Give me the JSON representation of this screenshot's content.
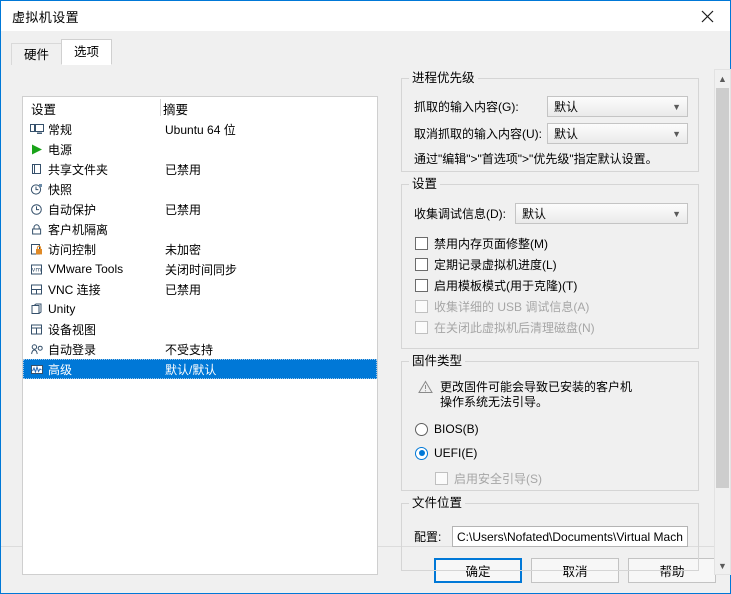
{
  "window": {
    "title": "虚拟机设置",
    "close_icon": "close-icon"
  },
  "tabs": [
    {
      "label": "硬件",
      "active": false
    },
    {
      "label": "选项",
      "active": true
    }
  ],
  "settings_list": {
    "columns": [
      "设置",
      "摘要"
    ],
    "rows": [
      {
        "icon": "monitor-icon",
        "label": "常规",
        "summary": "Ubuntu 64 位",
        "selected": false
      },
      {
        "icon": "power-play-icon",
        "label": "电源",
        "summary": "",
        "selected": false
      },
      {
        "icon": "shared-folder-icon",
        "label": "共享文件夹",
        "summary": "已禁用",
        "selected": false
      },
      {
        "icon": "snapshot-icon",
        "label": "快照",
        "summary": "",
        "selected": false
      },
      {
        "icon": "autoprotect-icon",
        "label": "自动保护",
        "summary": "已禁用",
        "selected": false
      },
      {
        "icon": "lock-icon",
        "label": "客户机隔离",
        "summary": "",
        "selected": false
      },
      {
        "icon": "access-control-icon",
        "label": "访问控制",
        "summary": "未加密",
        "selected": false
      },
      {
        "icon": "vmware-tools-icon",
        "label": "VMware Tools",
        "summary": "关闭时间同步",
        "selected": false
      },
      {
        "icon": "vnc-icon",
        "label": "VNC 连接",
        "summary": "已禁用",
        "selected": false
      },
      {
        "icon": "unity-icon",
        "label": "Unity",
        "summary": "",
        "selected": false
      },
      {
        "icon": "device-view-icon",
        "label": "设备视图",
        "summary": "",
        "selected": false
      },
      {
        "icon": "autologon-icon",
        "label": "自动登录",
        "summary": "不受支持",
        "selected": false
      },
      {
        "icon": "advanced-icon",
        "label": "高级",
        "summary": "默认/默认",
        "selected": true
      }
    ]
  },
  "options": {
    "process_priority": {
      "title": "进程优先级",
      "grab_label": "抓取的输入内容(G):",
      "grab_value": "默认",
      "ungrab_label": "取消抓取的输入内容(U):",
      "ungrab_value": "默认",
      "hint": "通过\"编辑\">\"首选项\">\"优先级\"指定默认设置。"
    },
    "settings": {
      "title": "设置",
      "debug_label": "收集调试信息(D):",
      "debug_value": "默认",
      "checkboxes": [
        {
          "label": "禁用内存页面修整(M)",
          "checked": false,
          "disabled": false
        },
        {
          "label": "定期记录虚拟机进度(L)",
          "checked": false,
          "disabled": false
        },
        {
          "label": "启用模板模式(用于克隆)(T)",
          "checked": false,
          "disabled": false
        },
        {
          "label": "收集详细的 USB 调试信息(A)",
          "checked": false,
          "disabled": true
        },
        {
          "label": "在关闭此虚拟机后清理磁盘(N)",
          "checked": false,
          "disabled": true
        }
      ]
    },
    "firmware": {
      "title": "固件类型",
      "warning_icon": "warning-triangle-icon",
      "warning_line1": "更改固件可能会导致已安装的客户机",
      "warning_line2": "操作系统无法引导。",
      "radios": [
        {
          "label": "BIOS(B)",
          "checked": false
        },
        {
          "label": "UEFI(E)",
          "checked": true
        }
      ],
      "secure_boot": {
        "label": "启用安全引导(S)",
        "checked": false,
        "disabled": true
      }
    },
    "file_location": {
      "title": "文件位置",
      "config_label": "配置:",
      "config_value": "C:\\Users\\Nofated\\Documents\\Virtual Mach"
    },
    "scrollbar": {
      "up_icon": "chevron-up-icon",
      "down_icon": "chevron-down-icon"
    }
  },
  "buttons": [
    {
      "label": "确定",
      "default": true
    },
    {
      "label": "取消",
      "default": false
    },
    {
      "label": "帮助",
      "default": false
    }
  ]
}
